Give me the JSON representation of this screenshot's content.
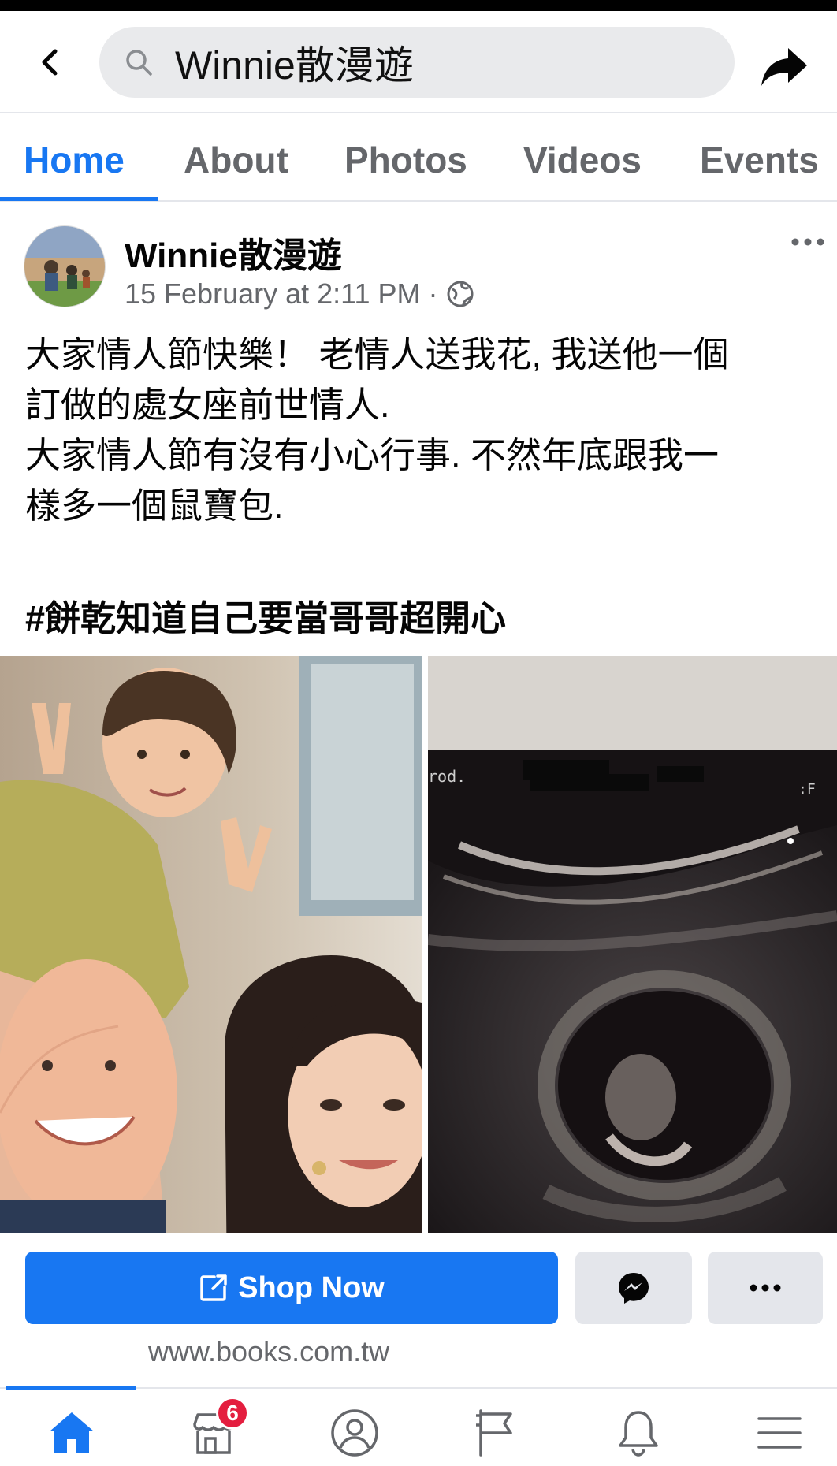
{
  "header": {
    "search_text": "Winnie散漫遊"
  },
  "tabs": [
    {
      "label": "Home",
      "active": true
    },
    {
      "label": "About",
      "active": false
    },
    {
      "label": "Photos",
      "active": false
    },
    {
      "label": "Videos",
      "active": false
    },
    {
      "label": "Events",
      "active": false
    }
  ],
  "post": {
    "author": "Winnie散漫遊",
    "timestamp": "15 February at 2:11 PM",
    "separator": "·",
    "text_lines": [
      "大家情人節快樂！ 老情人送我花, 我送他一個",
      "訂做的處女座前世情人.",
      "大家情人節有沒有小心行事. 不然年底跟我一",
      "樣多一個鼠寶包."
    ],
    "hashtag": "#餅乾知道自己要當哥哥超開心",
    "ultrasound_label_left": "rod.",
    "ultrasound_label_right": ":F"
  },
  "actions": {
    "shop_now_label": "Shop Now",
    "link_url": "www.books.com.tw"
  },
  "bottom_nav": {
    "items": [
      "home-icon",
      "marketplace-icon",
      "profile-icon",
      "pages-flag-icon",
      "notifications-bell-icon",
      "menu-icon"
    ],
    "marketplace_badge": "6"
  },
  "colors": {
    "accent": "#1877f2",
    "badge": "#e41e3f",
    "secondary_text": "#65676b"
  }
}
